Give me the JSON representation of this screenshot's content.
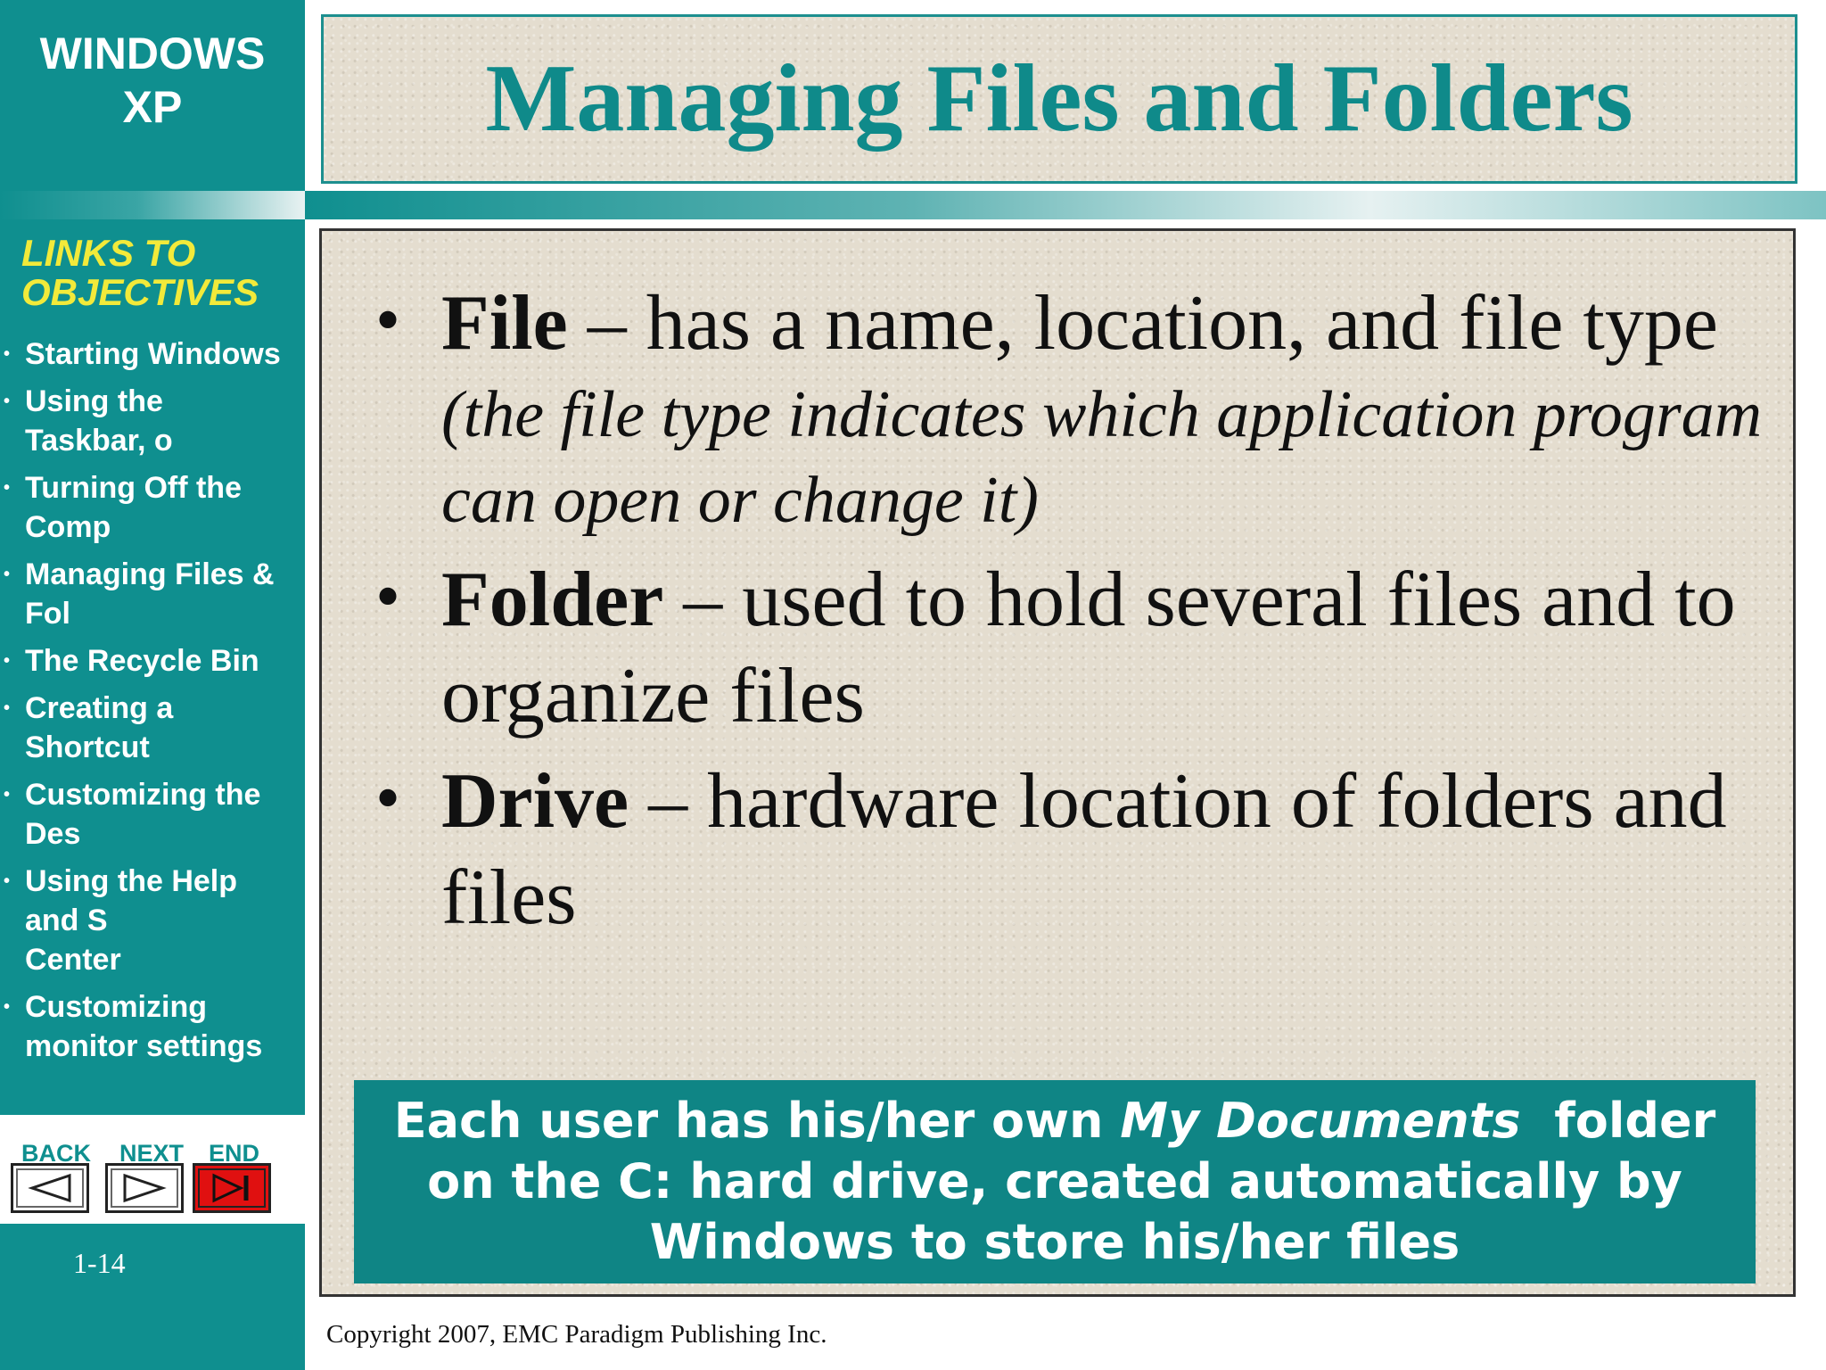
{
  "sidebar": {
    "brand": "WINDOWS\nXP",
    "links_title": "LINKS TO\nOBJECTIVES",
    "objectives": [
      "Starting Windows",
      "Using the Taskbar, o",
      "Turning Off the Comp",
      "Managing Files & Fol",
      "The Recycle Bin",
      "Creating a Shortcut",
      "Customizing the Des",
      "Using the Help and S\nCenter",
      "Customizing\nmonitor settings"
    ],
    "bullet": "•",
    "nav": {
      "back_label": "BACK",
      "next_label": "NEXT",
      "end_label": "END",
      "back_icon": "triangle-left-icon",
      "next_icon": "triangle-right-icon",
      "end_icon": "skip-to-end-icon",
      "end_color": "#e01010"
    },
    "slide_number": "1-14"
  },
  "slide": {
    "title": "Managing Files and Folders",
    "bullet": "•",
    "bullets": [
      {
        "term": "File",
        "text": " – has a name, location, and file type",
        "note": "(the file type indicates which application program can open or change it)"
      },
      {
        "term": "Folder",
        "text": " – used to hold several files and to organize files",
        "note": ""
      },
      {
        "term": "Drive",
        "text": " – hardware location of folders and files",
        "note": ""
      }
    ],
    "callout": {
      "before": "Each user has his/her own ",
      "emphasis": "My Documents",
      "after": "  folder on the C: hard drive, created automatically by Windows to store his/her files"
    }
  },
  "footer": {
    "copyright": "Copyright 2007, EMC Paradigm Publishing Inc."
  },
  "colors": {
    "teal": "#0f8f8f",
    "title_teal": "#0f8a8a",
    "links_yellow": "#f2ea3a",
    "paper": "#e4ddcf"
  }
}
